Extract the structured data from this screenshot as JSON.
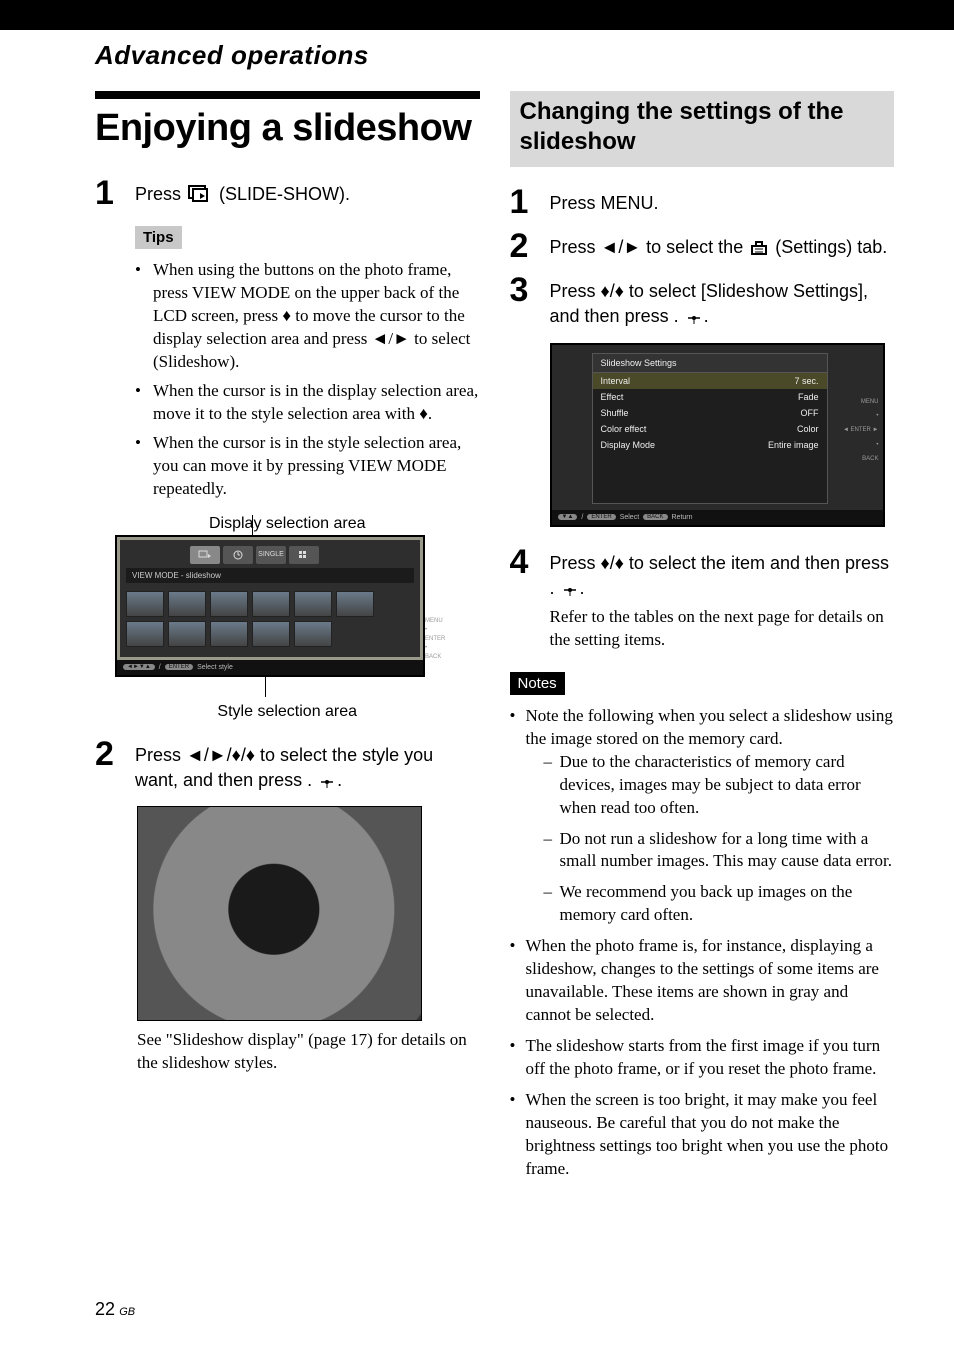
{
  "header": {
    "section": "Advanced operations"
  },
  "left": {
    "title": "Enjoying a slideshow",
    "step1_pre": "Press ",
    "step1_post": " (SLIDE-SHOW).",
    "tips_label": "Tips",
    "tips": [
      "When using the buttons on the photo frame, press VIEW MODE on the upper back of the LCD screen, press ♦ to move the cursor to the display selection area and press ◄/► to select        (Slideshow).",
      "When the cursor is in the display selection area, move it to the style selection area with ♦.",
      "When the cursor is in the style selection area, you can move it by pressing VIEW MODE repeatedly."
    ],
    "caption_top": "Display selection area",
    "screenshot1": {
      "mode_bar": "VIEW MODE - slideshow",
      "tab3": "SINGLE",
      "side": [
        "MENU",
        "",
        "ENTER",
        "",
        "BACK"
      ],
      "bottom_enter": "ENTER",
      "bottom_text": "Select style"
    },
    "caption_bottom": "Style selection area",
    "step2": "Press ◄/►/♦/♦ to select the style you want, and then press    .",
    "after_img": "See \"Slideshow display\" (page 17) for details on the slideshow styles."
  },
  "right": {
    "subtitle": "Changing the settings of the slideshow",
    "step1": "Press MENU.",
    "step2_pre": "Press ◄/► to select the ",
    "step2_post": " (Settings) tab.",
    "step3": "Press ♦/♦ to select [Slideshow Settings], and then press    .",
    "settings_shot": {
      "title": "Slideshow Settings",
      "rows": [
        {
          "k": "Interval",
          "v": "7 sec."
        },
        {
          "k": "Effect",
          "v": "Fade"
        },
        {
          "k": "Shuffle",
          "v": "OFF"
        },
        {
          "k": "Color effect",
          "v": "Color"
        },
        {
          "k": "Display Mode",
          "v": "Entire image"
        }
      ],
      "side": [
        "MENU",
        "",
        "ENTER",
        "",
        "BACK"
      ],
      "bottom_enter": "ENTER",
      "bottom_select": "Select",
      "bottom_back": "BACK",
      "bottom_return": "Return"
    },
    "step4_a": "Press ♦/♦ to select the item and then press    .",
    "step4_b": "Refer to the tables on the next page for details on the setting items.",
    "notes_label": "Notes",
    "notes": [
      {
        "text": "Note the following when you select a slideshow using the image stored on the memory card.",
        "sub": [
          "Due to the characteristics of memory card devices, images may be subject to data error when read too often.",
          "Do not run a slideshow for a long time with a small number images. This may cause data error.",
          "We recommend you back up images on the memory card often."
        ]
      },
      {
        "text": "When the photo frame is, for instance, displaying a slideshow, changes to the settings of some items are unavailable. These items are shown in gray and cannot be selected."
      },
      {
        "text": "The slideshow starts from the first image if you turn off the photo frame, or if you reset the photo frame."
      },
      {
        "text": "When the screen is too bright, it may make you feel nauseous. Be careful that you do not make the brightness settings too bright when you use the photo frame."
      }
    ]
  },
  "footer": {
    "page": "22",
    "region": "GB"
  }
}
